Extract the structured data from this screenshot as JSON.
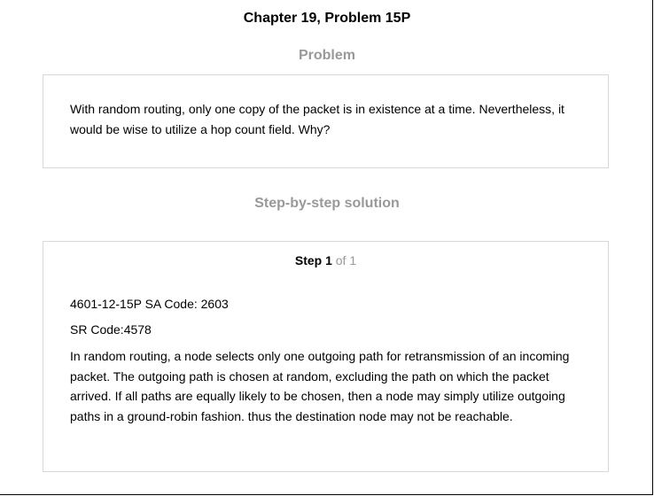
{
  "header": {
    "chapter_title": "Chapter 19, Problem 15P"
  },
  "problem": {
    "heading": "Problem",
    "text": "With random routing, only one copy of the packet is in existence at a time. Nevertheless, it would be wise to utilize a hop count field. Why?"
  },
  "solution": {
    "heading": "Step-by-step solution",
    "step_label": "Step 1",
    "step_of": " of 1",
    "lines": [
      "4601-12-15P SA Code: 2603",
      "SR Code:4578"
    ],
    "paragraph": "In random routing, a node selects only one outgoing path for retransmission of an incoming packet. The outgoing path is chosen at random, excluding the path on which the packet arrived. If all paths are equally likely to be chosen, then a node may simply utilize outgoing paths in a ground-robin fashion. thus the destination node may not be reachable."
  }
}
